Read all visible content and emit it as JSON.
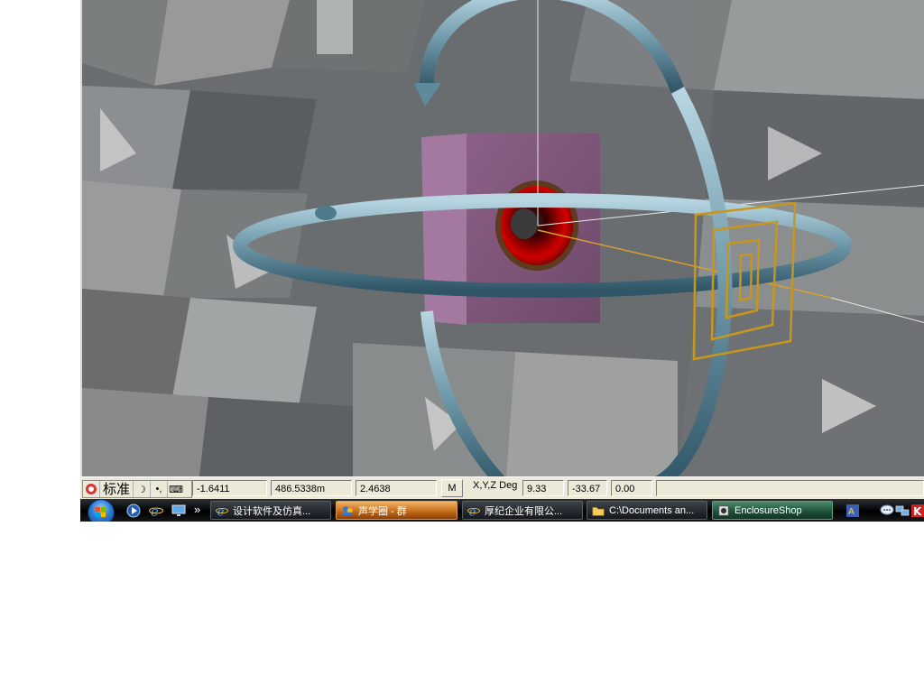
{
  "scene": {
    "description_label": ""
  },
  "statusbar": {
    "ime": {
      "mode_label": "标准",
      "moon_glyph": "☽",
      "punct_glyph": "•,",
      "keyboard_glyph": "⌨"
    },
    "x_value": "-1.6411",
    "y_value": "486.5338m",
    "z_value": "2.4638",
    "m_button": "M",
    "deg_label": "X,Y,Z Deg",
    "deg_x": "9.33",
    "deg_y": "-33.67",
    "deg_z": "0.00"
  },
  "taskbar": {
    "quick_launch_more": "»",
    "tasks": [
      {
        "label": "设计软件及仿真...",
        "icon": "ie-icon"
      },
      {
        "label": "声学圈 - 群",
        "icon": "qq-group-icon"
      },
      {
        "label": "厚纪企业有限公...",
        "icon": "ie-icon"
      },
      {
        "label": "C:\\Documents an...",
        "icon": "folder-icon"
      },
      {
        "label": "EnclosureShop",
        "icon": "app-icon"
      }
    ]
  },
  "colors": {
    "box": "#9c6f96",
    "ring": "#6e98a8",
    "gizmo": "#c89a1a",
    "driver_red": "#c40000"
  }
}
